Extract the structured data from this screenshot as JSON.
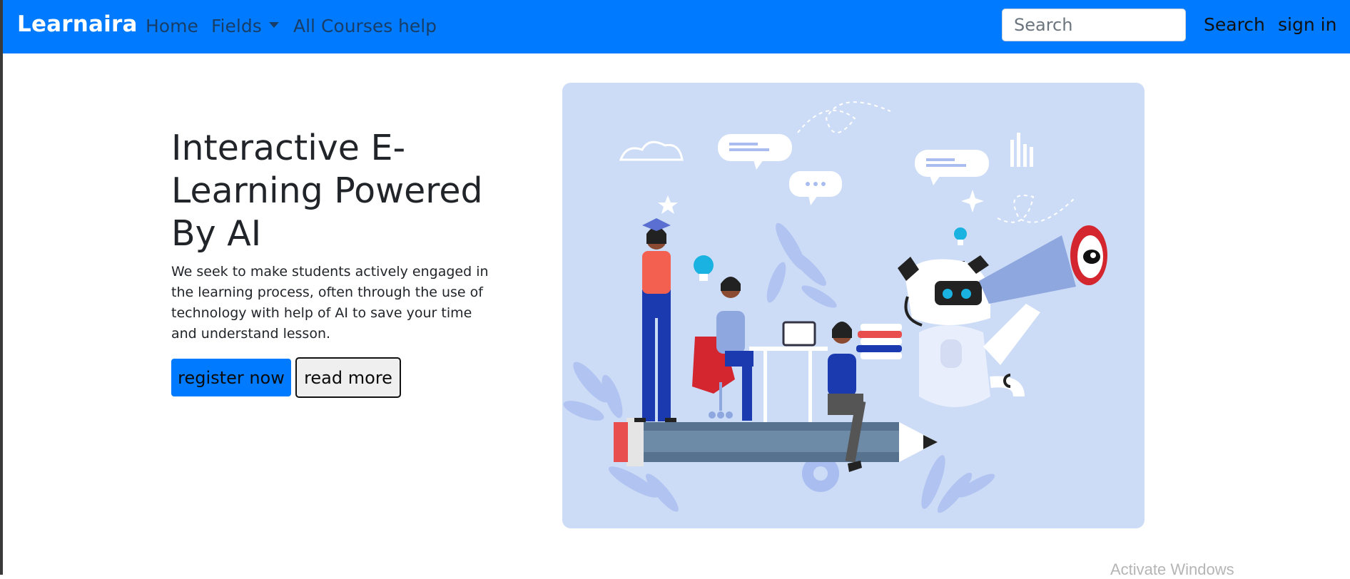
{
  "navbar": {
    "brand": "Learnaira",
    "links": {
      "home": "Home",
      "fields": "Fields",
      "all_courses": "All Courses",
      "help": "help"
    },
    "search": {
      "placeholder": "Search",
      "button_label": "Search"
    },
    "sign_in": "sign in",
    "background_color": "#007bff"
  },
  "hero": {
    "title": "Interactive E-Learning Powered By AI",
    "description": "We seek to make students actively engaged in the learning process, often through the use of technology with help of AI to save your time and understand lesson.",
    "buttons": {
      "register": "register now",
      "read_more": "read more"
    },
    "illustration_icon": "e-learning-ai-illustration",
    "illustration_bg": "#ccdcf6"
  },
  "watermark": "Activate Windows"
}
